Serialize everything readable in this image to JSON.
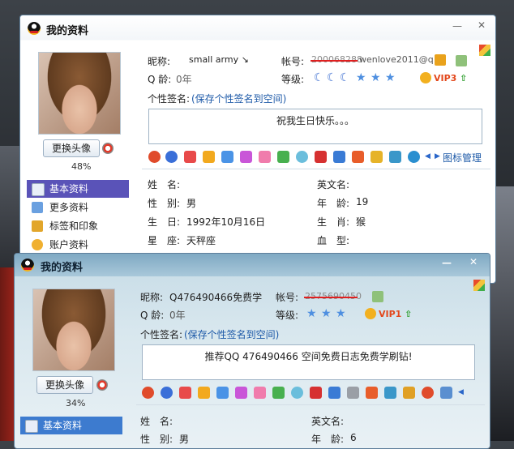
{
  "colors": {
    "accent": "#5a53b8",
    "link": "#1e5aa8",
    "vip": "#e3471b"
  },
  "window1": {
    "title": "我的资料",
    "change_avatar": "更换头像",
    "percent": "48%",
    "nickname_label": "昵称:",
    "nickname": "small army ↘",
    "account_label": "帐号:",
    "account_struck": "200068288",
    "account_rest": "wenlove2011@q",
    "age_label": "Q 龄:",
    "age": "0年",
    "level_label": "等级:",
    "vip": "VIP3",
    "signature_label": "个性签名:",
    "signature_link": "(保存个性签名到空间)",
    "signature": "祝我生日快乐。。。",
    "icon_manage": "图标管理",
    "sidebar": [
      {
        "label": "基本资料",
        "icon": "card-icon",
        "active": true
      },
      {
        "label": "更多资料",
        "icon": "list-icon",
        "active": false
      },
      {
        "label": "标签和印象",
        "icon": "tag-icon",
        "active": false
      },
      {
        "label": "账户资料",
        "icon": "user-icon",
        "active": false
      }
    ],
    "fields_left": [
      {
        "label": "姓　名:",
        "value": ""
      },
      {
        "label": "性　别:",
        "value": "男"
      },
      {
        "label": "生　日:",
        "value": "1992年10月16日"
      },
      {
        "label": "星　座:",
        "value": "天秤座"
      }
    ],
    "fields_right": [
      {
        "label": "英文名:",
        "value": ""
      },
      {
        "label": "年　龄:",
        "value": "19"
      },
      {
        "label": "生　肖:",
        "value": "猴"
      },
      {
        "label": "血　型:",
        "value": ""
      }
    ]
  },
  "window2": {
    "title": "我的资料",
    "change_avatar": "更换头像",
    "percent": "34%",
    "nickname_label": "昵称:",
    "nickname": "Q476490466免费学",
    "account_label": "帐号:",
    "account_struck": "2575690450",
    "age_label": "Q 龄:",
    "age": "0年",
    "level_label": "等级:",
    "vip": "VIP1",
    "signature_label": "个性签名:",
    "signature_link": "(保存个性签名到空间)",
    "signature": "推荐QQ 476490466 空间免费日志免费学刷钻!",
    "sidebar": [
      {
        "label": "基本资料",
        "icon": "card-icon",
        "active": true
      }
    ],
    "fields_left": [
      {
        "label": "姓　名:",
        "value": ""
      },
      {
        "label": "性　别:",
        "value": "男"
      }
    ],
    "fields_right": [
      {
        "label": "英文名:",
        "value": ""
      },
      {
        "label": "年　龄:",
        "value": "6"
      }
    ]
  }
}
